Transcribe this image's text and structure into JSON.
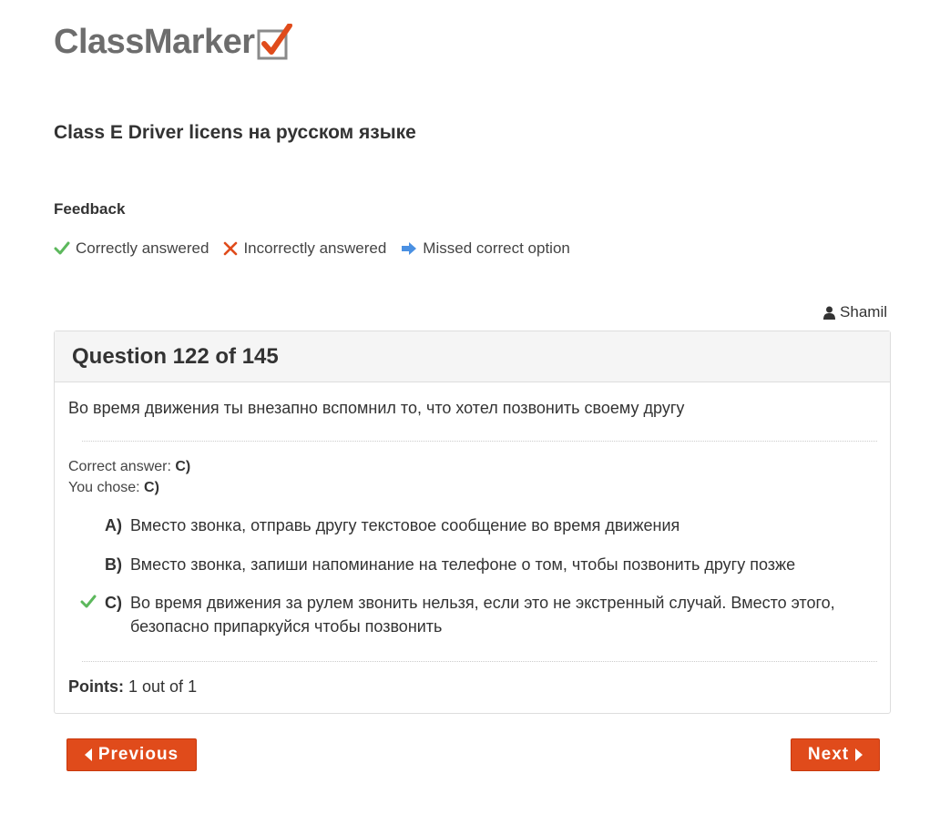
{
  "brand": {
    "logo_text": "ClassMarker",
    "check_color": "#e04b1b"
  },
  "quiz": {
    "title": "Class E Driver licens на русском языке"
  },
  "feedback": {
    "heading": "Feedback",
    "legend": {
      "correct": {
        "icon": "check-icon",
        "label": "Correctly answered",
        "color": "#5cb85c"
      },
      "incorrect": {
        "icon": "x-icon",
        "label": "Incorrectly answered",
        "color": "#e04b1b"
      },
      "missed": {
        "icon": "arrow-right-icon",
        "label": "Missed correct option",
        "color": "#4a90e2"
      }
    }
  },
  "user": {
    "icon": "user-icon",
    "name": "Shamil"
  },
  "question": {
    "header": "Question 122 of 145",
    "text": "Во время движения ты внезапно вспомнил то, что хотел позвонить своему другу",
    "correct_answer_label": "Correct answer:",
    "correct_answer_value": "C)",
    "you_chose_label": "You chose:",
    "you_chose_value": "C)",
    "options": [
      {
        "letter": "A)",
        "text": "Вместо звонка, отправь другу текстовое сообщение во время движения",
        "marked_correct": false
      },
      {
        "letter": "B)",
        "text": "Вместо звонка, запиши напоминание на телефоне о том, чтобы позвонить другу позже",
        "marked_correct": false
      },
      {
        "letter": "C)",
        "text": "Во время движения за рулем звонить нельзя, если это не экстренный случай. Вместо этого, безопасно припаркуйся чтобы позвонить",
        "marked_correct": true
      }
    ],
    "points_label": "Points:",
    "points_value": "1 out of 1"
  },
  "nav": {
    "previous_label": "Previous",
    "next_label": "Next",
    "button_color": "#e04b1b"
  }
}
